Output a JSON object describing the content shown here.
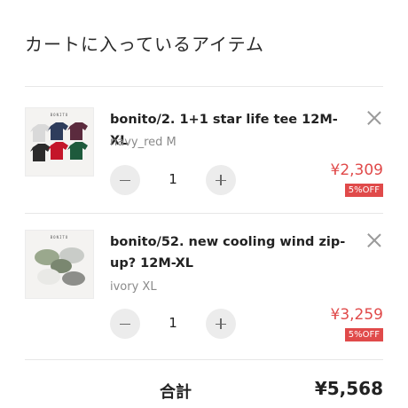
{
  "cart": {
    "title": "カートに入っているアイテム",
    "items": [
      {
        "name": "bonito/2. 1+1 star life tee 12M-XL",
        "variant": "navy_red M",
        "quantity": "1",
        "price": "¥2,309",
        "discount": "5%OFF",
        "thumb_brand": "BONITO"
      },
      {
        "name": "bonito/52. new cooling wind zip-up? 12M-XL",
        "variant": "ivory XL",
        "quantity": "1",
        "price": "¥3,259",
        "discount": "5%OFF",
        "thumb_brand": "BONITO"
      }
    ],
    "total_label": "合計",
    "total_value": "¥5,568"
  },
  "colors": {
    "price": "#e04a4a",
    "badge_bg": "#e04a4a",
    "stepper_bg": "#ececec",
    "divider": "#e7e7e7"
  },
  "icons": {
    "remove": "close-icon",
    "decrement": "minus-icon",
    "increment": "plus-icon"
  }
}
